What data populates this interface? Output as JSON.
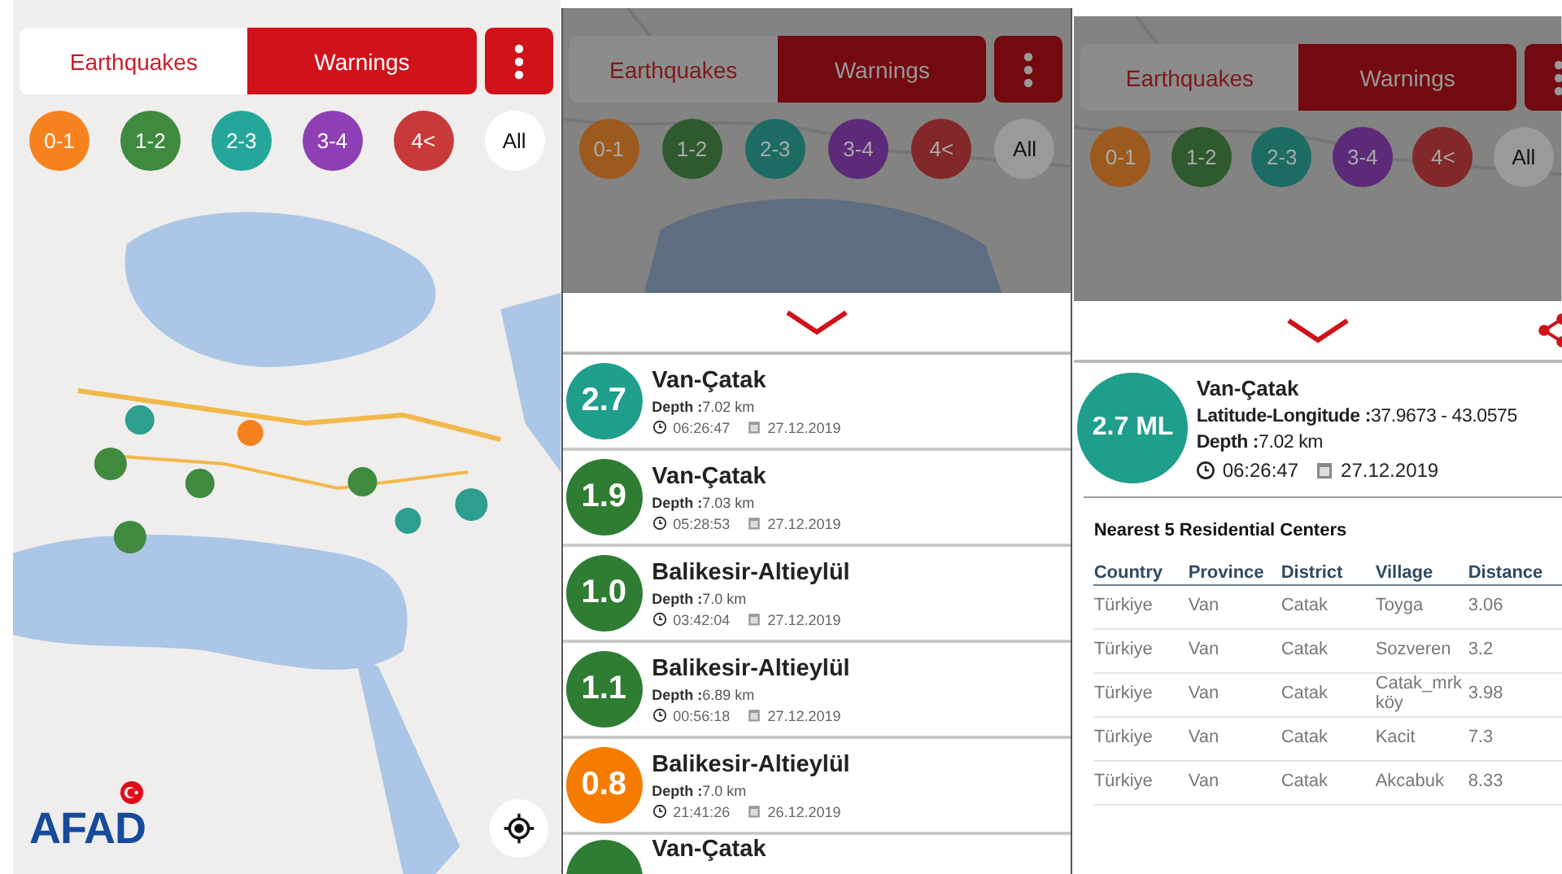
{
  "screens": [
    {
      "kind": "map",
      "dimmed": false,
      "tabs": [
        {
          "label": "Earthquakes",
          "selected": true
        },
        {
          "label": "Warnings",
          "selected": false
        }
      ],
      "filters": [
        {
          "label": "0-1",
          "color": "#f5821f"
        },
        {
          "label": "1-2",
          "color": "#3f8a3f"
        },
        {
          "label": "2-3",
          "color": "#26a69a"
        },
        {
          "label": "3-4",
          "color": "#8e3fb5"
        },
        {
          "label": "4<",
          "color": "#c83a3a"
        },
        {
          "label": "All",
          "color": "#ffffff"
        }
      ],
      "logo": "AFAD"
    },
    {
      "kind": "list",
      "dimmed": true,
      "tabs": [
        {
          "label": "Earthquakes",
          "selected": true
        },
        {
          "label": "Warnings",
          "selected": false
        }
      ],
      "filters": [
        {
          "label": "0-1",
          "color": "#9c5a1e"
        },
        {
          "label": "1-2",
          "color": "#2e5a2e"
        },
        {
          "label": "2-3",
          "color": "#1d6c64"
        },
        {
          "label": "3-4",
          "color": "#5c2a78"
        },
        {
          "label": "4<",
          "color": "#822828"
        },
        {
          "label": "All",
          "color": "#9a9a9a"
        }
      ],
      "events": [
        {
          "magnitude": "2.7",
          "color": "#1f9e8c",
          "place": "Van-Çatak",
          "depth": "**Depth :**7.02 km",
          "time": "06:26:47",
          "date": "27.12.2019"
        },
        {
          "magnitude": "1.9",
          "color": "#2e7d32",
          "place": "Van-Çatak",
          "depth": "**Depth :**7.03 km",
          "time": "05:28:53",
          "date": "27.12.2019"
        },
        {
          "magnitude": "1.0",
          "color": "#2e7d32",
          "place": "Balikesir-Altieylül",
          "depth": "**Depth :**7.0 km",
          "time": "03:42:04",
          "date": "27.12.2019"
        },
        {
          "magnitude": "1.1",
          "color": "#2e7d32",
          "place": "Balikesir-Altieylül",
          "depth": "**Depth :**6.89 km",
          "time": "00:56:18",
          "date": "27.12.2019"
        },
        {
          "magnitude": "0.8",
          "color": "#f57c00",
          "place": "Balikesir-Altieylül",
          "depth": "**Depth :**7.0 km",
          "time": "21:41:26",
          "date": "26.12.2019"
        },
        {
          "color": "#2e7d32",
          "place": "Van-Çatak"
        }
      ]
    },
    {
      "kind": "detail",
      "dimmed": true,
      "tabs": [
        {
          "label": "Earthquakes",
          "selected": true
        },
        {
          "label": "Warnings",
          "selected": false
        }
      ],
      "filters": [
        {
          "label": "0-1",
          "color": "#9c5a1e"
        },
        {
          "label": "1-2",
          "color": "#2e5a2e"
        },
        {
          "label": "2-3",
          "color": "#1d6c64"
        },
        {
          "label": "3-4",
          "color": "#5c2a78"
        },
        {
          "label": "4<",
          "color": "#822828"
        },
        {
          "label": "All",
          "color": "#9a9a9a"
        }
      ],
      "detail": {
        "magnitude": "2.7 ML",
        "color": "#1f9e8c",
        "place": "Van-Çatak",
        "coordinates": "**Latitude-Longitude :**37.9673 - 43.0575",
        "depth": "**Depth :**7.02 km",
        "time": "06:26:47",
        "date": "27.12.2019"
      },
      "nearest": {
        "title": "Nearest 5 Residential Centers",
        "columns": [
          "Country",
          "Province",
          "District",
          "Village",
          "Distance"
        ],
        "rows": [
          [
            "Türkiye",
            "Van",
            "Catak",
            "Toyga",
            "3.06"
          ],
          [
            "Türkiye",
            "Van",
            "Catak",
            "Sozveren",
            "3.2"
          ],
          [
            "Türkiye",
            "Van",
            "Catak",
            "Catak_mrkköy",
            "3.98"
          ],
          [
            "Türkiye",
            "Van",
            "Catak",
            "Kacit",
            "7.3"
          ],
          [
            "Türkiye",
            "Van",
            "Catak",
            "Akcabuk",
            "8.33"
          ]
        ]
      }
    }
  ]
}
